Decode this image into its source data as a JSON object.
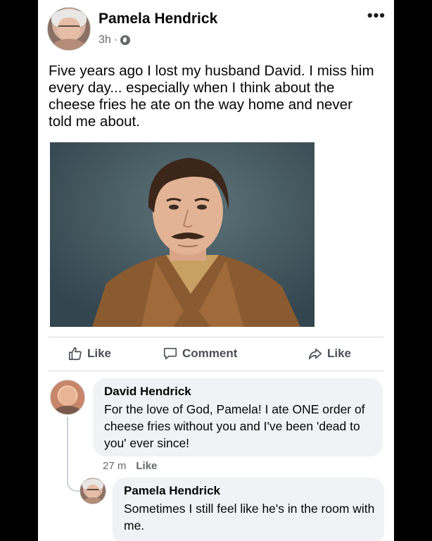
{
  "post": {
    "author": "Pamela Hendrick",
    "time": "3h",
    "separator": "·",
    "privacy_icon": "globe-icon",
    "more_icon": "•••",
    "text": "Five years ago I lost my husband David. I miss him every day... especially when I think about the cheese fries he ate on the way home and never told me about.",
    "photo_alt": "portrait-photo"
  },
  "actions": {
    "like": "Like",
    "comment": "Comment",
    "share_like": "Like"
  },
  "comments": [
    {
      "author": "David Hendrick",
      "text": "For the love of God, Pamela! I ate ONE order of cheese fries without you and I've been 'dead to you' ever since!",
      "time": "27 m",
      "like_label": "Like"
    }
  ],
  "replies": [
    {
      "author": "Pamela Hendrick",
      "text": "Sometimes I still feel like he's in the room with me."
    }
  ],
  "colors": {
    "background": "#000000",
    "card": "#ffffff",
    "bubble": "#f0f2f5",
    "secondary_text": "#65676b"
  }
}
